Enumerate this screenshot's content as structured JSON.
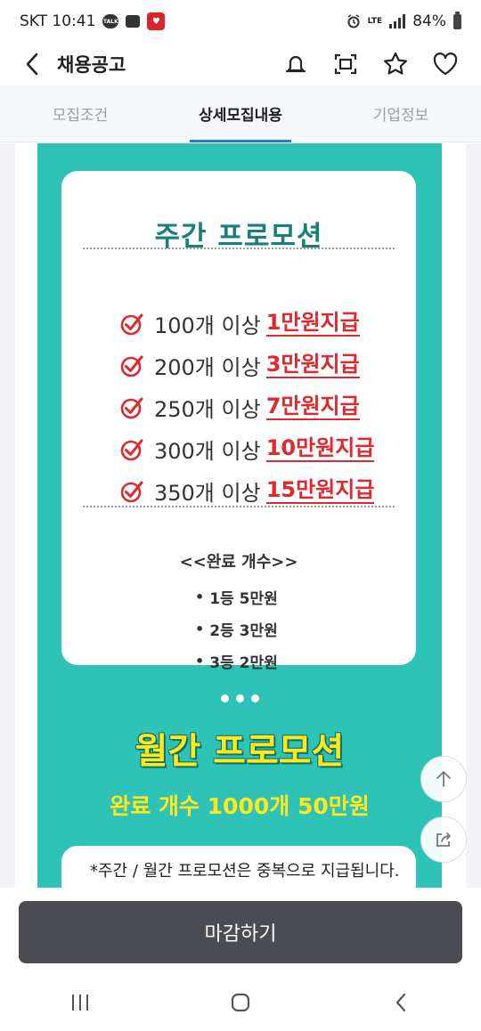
{
  "status_bar": {
    "carrier_time": "SKT 10:41",
    "talk_badge": "TALK",
    "network": "LTE",
    "battery": "84%"
  },
  "header": {
    "title": "채용공고",
    "icons": [
      "chevron-left-icon",
      "bell-icon",
      "scan-icon",
      "star-icon",
      "heart-icon"
    ]
  },
  "tabs": [
    {
      "label": "모집조건",
      "active": false
    },
    {
      "label": "상세모집내용",
      "active": true
    },
    {
      "label": "기업정보",
      "active": false
    }
  ],
  "weekly": {
    "title": "주간 프로모션",
    "items": [
      {
        "condition": "100개 이상",
        "reward": "1만원지급"
      },
      {
        "condition": "200개 이상",
        "reward": "3만원지급"
      },
      {
        "condition": "250개 이상",
        "reward": "7만원지급"
      },
      {
        "condition": "300개 이상",
        "reward": "10만원지급"
      },
      {
        "condition": "350개 이상",
        "reward": "15만원지급"
      }
    ],
    "rank_title": "<<완료 개수>>",
    "ranks": [
      "1등 5만원",
      "2등 3만원",
      "3등 2만원"
    ]
  },
  "monthly": {
    "title": "월간 프로모션",
    "subtitle": "완료 개수 1000개 50만원"
  },
  "note": {
    "text": "*주간 / 월간 프로모션은 중복으로 지급됩니다."
  },
  "cta": {
    "label": "마감하기"
  },
  "colors": {
    "teal": "#2fc2b7",
    "dark_teal": "#17807b",
    "red": "#e0282f",
    "yellow": "#ffe81c",
    "tab_indicator": "#2f7cc6",
    "cta_bg": "#4b4c52"
  }
}
